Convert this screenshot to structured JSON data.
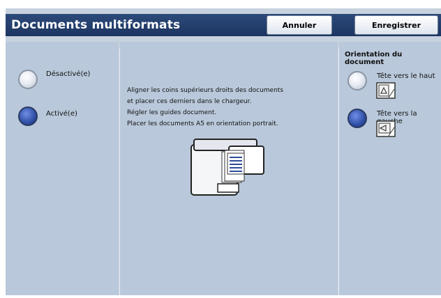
{
  "header": {
    "title": "Documents multiformats",
    "cancel_label": "Annuler",
    "save_label": "Enregistrer"
  },
  "mode": {
    "options": [
      {
        "label": "Désactivé(e)",
        "selected": false
      },
      {
        "label": "Activé(e)",
        "selected": true
      }
    ]
  },
  "instructions": {
    "line1": "Aligner les coins supérieurs droits des documents",
    "line2": "et placer ces derniers dans le chargeur.",
    "line3": "Régler les guides document.",
    "line4": "Placer les documents A5 en orientation portrait."
  },
  "orientation": {
    "title": "Orientation du document",
    "options": [
      {
        "label": "Tête vers le haut",
        "selected": false,
        "icon": "head-up-icon"
      },
      {
        "label": "Tête vers la gauche",
        "selected": true,
        "icon": "head-left-icon"
      }
    ]
  },
  "colors": {
    "titlebar": "#1f3766",
    "panel": "#b9c8da",
    "radio_selected": "#2f4fa6"
  }
}
